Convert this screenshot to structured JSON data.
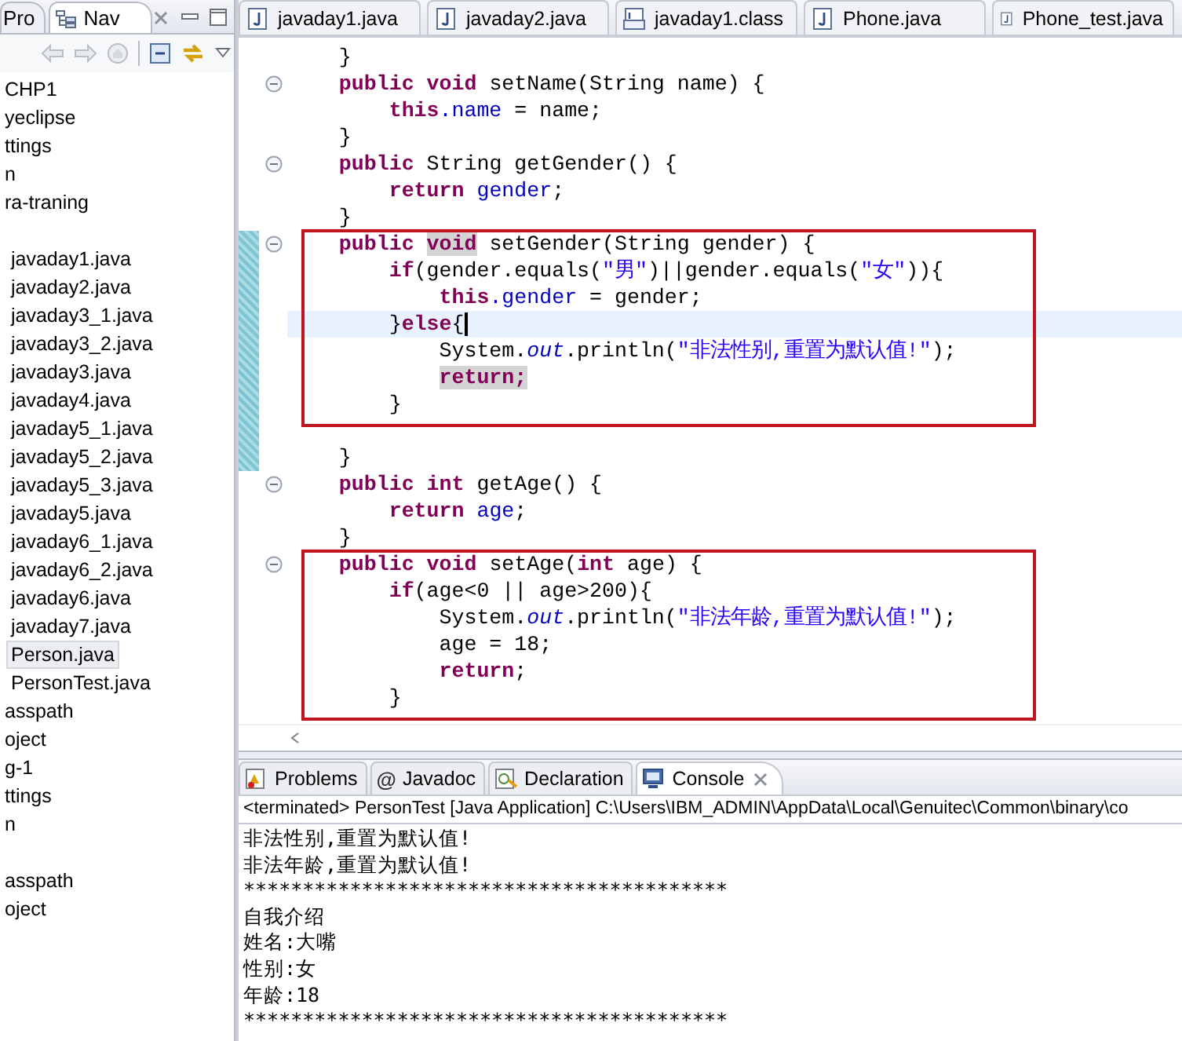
{
  "navigator": {
    "tabs": [
      {
        "label": "Pro",
        "selected": false
      },
      {
        "label": "Nav",
        "selected": true
      }
    ],
    "tree": [
      {
        "kind": "row",
        "label": "CHP1"
      },
      {
        "kind": "row",
        "label": "yeclipse"
      },
      {
        "kind": "row",
        "label": "ttings"
      },
      {
        "kind": "row",
        "label": "n"
      },
      {
        "kind": "row",
        "label": "ra-traning"
      },
      {
        "kind": "blank",
        "children": [
          {
            "label": "javaday1.java",
            "selected": false
          },
          {
            "label": "javaday2.java",
            "selected": false
          },
          {
            "label": "javaday3_1.java",
            "selected": false
          },
          {
            "label": "javaday3_2.java",
            "selected": false
          },
          {
            "label": "javaday3.java",
            "selected": false
          },
          {
            "label": "javaday4.java",
            "selected": false
          },
          {
            "label": "javaday5_1.java",
            "selected": false
          },
          {
            "label": "javaday5_2.java",
            "selected": false
          },
          {
            "label": "javaday5_3.java",
            "selected": false
          },
          {
            "label": "javaday5.java",
            "selected": false
          },
          {
            "label": "javaday6_1.java",
            "selected": false
          },
          {
            "label": "javaday6_2.java",
            "selected": false
          },
          {
            "label": "javaday6.java",
            "selected": false
          },
          {
            "label": "javaday7.java",
            "selected": false
          },
          {
            "label": "Person.java",
            "selected": true
          },
          {
            "label": "PersonTest.java",
            "selected": false
          }
        ]
      },
      {
        "kind": "row",
        "label": "asspath"
      },
      {
        "kind": "row",
        "label": "oject"
      },
      {
        "kind": "row",
        "label": "g-1"
      },
      {
        "kind": "row",
        "label": "ttings"
      },
      {
        "kind": "row",
        "label": "n"
      },
      {
        "kind": "blank"
      },
      {
        "kind": "row",
        "label": "asspath"
      },
      {
        "kind": "row",
        "label": "oject"
      }
    ]
  },
  "editor": {
    "tabs": [
      {
        "label": "javaday1.java",
        "kind": "java"
      },
      {
        "label": "javaday2.java",
        "kind": "java"
      },
      {
        "label": "javaday1.class",
        "kind": "class"
      },
      {
        "label": "Phone.java",
        "kind": "java"
      },
      {
        "label": "Phone_test.java",
        "kind": "java"
      }
    ],
    "blocks": [
      {
        "boxed": false,
        "lines": [
          {
            "tokens": [
              {
                "kind": "plain",
                "text": "    }"
              }
            ],
            "foldable": false,
            "changed": false,
            "current": false
          },
          {
            "tokens": [
              {
                "kind": "keyword",
                "text": "    public"
              },
              {
                "kind": "keyword",
                "text": " void"
              },
              {
                "kind": "plain",
                "text": " setName(String name) {"
              }
            ],
            "foldable": true,
            "changed": false,
            "current": false
          },
          {
            "tokens": [
              {
                "kind": "keyword",
                "text": "        this"
              },
              {
                "kind": "field",
                "text": ".name"
              },
              {
                "kind": "plain",
                "text": " = name;"
              }
            ],
            "foldable": false,
            "changed": false,
            "current": false
          },
          {
            "tokens": [
              {
                "kind": "plain",
                "text": "    }"
              }
            ],
            "foldable": false,
            "changed": false,
            "current": false
          },
          {
            "tokens": [
              {
                "kind": "keyword",
                "text": "    public"
              },
              {
                "kind": "plain",
                "text": " String getGender() {"
              }
            ],
            "foldable": true,
            "changed": false,
            "current": false
          },
          {
            "tokens": [
              {
                "kind": "keyword",
                "text": "        return"
              },
              {
                "kind": "field",
                "text": " gender"
              },
              {
                "kind": "plain",
                "text": ";"
              }
            ],
            "foldable": false,
            "changed": false,
            "current": false
          },
          {
            "tokens": [
              {
                "kind": "plain",
                "text": "    }"
              }
            ],
            "foldable": false,
            "changed": false,
            "current": false
          }
        ]
      },
      {
        "boxed": true,
        "lines": [
          {
            "tokens": [
              {
                "kind": "keyword",
                "text": "    public"
              },
              {
                "kind": "keyword-marked",
                "text": " void"
              },
              {
                "kind": "plain",
                "text": " setGender(String gender) {"
              }
            ],
            "foldable": true,
            "changed": true,
            "current": false
          },
          {
            "tokens": [
              {
                "kind": "keyword",
                "text": "        if"
              },
              {
                "kind": "plain",
                "text": "(gender.equals("
              },
              {
                "kind": "string",
                "text": "\"男\""
              },
              {
                "kind": "plain",
                "text": ")||gender.equals("
              },
              {
                "kind": "string",
                "text": "\"女\""
              },
              {
                "kind": "plain",
                "text": ")){"
              }
            ],
            "foldable": false,
            "changed": true,
            "current": false
          },
          {
            "tokens": [
              {
                "kind": "keyword",
                "text": "            this"
              },
              {
                "kind": "field",
                "text": ".gender"
              },
              {
                "kind": "plain",
                "text": " = gender;"
              }
            ],
            "foldable": false,
            "changed": true,
            "current": false
          },
          {
            "tokens": [
              {
                "kind": "plain",
                "text": "        }"
              },
              {
                "kind": "keyword",
                "text": "else"
              },
              {
                "kind": "plain",
                "text": "{"
              }
            ],
            "foldable": false,
            "changed": true,
            "current": true
          },
          {
            "tokens": [
              {
                "kind": "plain",
                "text": "            System."
              },
              {
                "kind": "static",
                "text": "out"
              },
              {
                "kind": "plain",
                "text": ".println("
              },
              {
                "kind": "string",
                "text": "\"非法性别,重置为默认值!\""
              },
              {
                "kind": "plain",
                "text": ");"
              }
            ],
            "foldable": false,
            "changed": true,
            "current": false
          },
          {
            "tokens": [
              {
                "kind": "keyword-marked",
                "text": "            return;"
              }
            ],
            "foldable": false,
            "changed": true,
            "current": false
          },
          {
            "tokens": [
              {
                "kind": "plain",
                "text": "        }"
              }
            ],
            "foldable": false,
            "changed": true,
            "current": false
          }
        ]
      },
      {
        "boxed": false,
        "lines": [
          {
            "foldable": false,
            "changed": true,
            "current": false
          },
          {
            "tokens": [
              {
                "kind": "plain",
                "text": "    }"
              }
            ],
            "foldable": false,
            "changed": true,
            "current": false
          },
          {
            "tokens": [
              {
                "kind": "keyword",
                "text": "    public"
              },
              {
                "kind": "keyword",
                "text": " int"
              },
              {
                "kind": "plain",
                "text": " getAge() {"
              }
            ],
            "foldable": true,
            "changed": false,
            "current": false
          },
          {
            "tokens": [
              {
                "kind": "keyword",
                "text": "        return"
              },
              {
                "kind": "field",
                "text": " age"
              },
              {
                "kind": "plain",
                "text": ";"
              }
            ],
            "foldable": false,
            "changed": false,
            "current": false
          },
          {
            "tokens": [
              {
                "kind": "plain",
                "text": "    }"
              }
            ],
            "foldable": false,
            "changed": false,
            "current": false
          }
        ]
      },
      {
        "boxed": true,
        "lines": [
          {
            "tokens": [
              {
                "kind": "keyword",
                "text": "    public"
              },
              {
                "kind": "keyword",
                "text": " void"
              },
              {
                "kind": "plain",
                "text": " setAge("
              },
              {
                "kind": "keyword",
                "text": "int"
              },
              {
                "kind": "plain",
                "text": " age) {"
              }
            ],
            "foldable": true,
            "changed": false,
            "current": false
          },
          {
            "tokens": [
              {
                "kind": "keyword",
                "text": "        if"
              },
              {
                "kind": "plain",
                "text": "(age<0 || age>200){"
              }
            ],
            "foldable": false,
            "changed": false,
            "current": false
          },
          {
            "tokens": [
              {
                "kind": "plain",
                "text": "            System."
              },
              {
                "kind": "static",
                "text": "out"
              },
              {
                "kind": "plain",
                "text": ".println("
              },
              {
                "kind": "string",
                "text": "\"非法年龄,重置为默认值!\""
              },
              {
                "kind": "plain",
                "text": ");"
              }
            ],
            "foldable": false,
            "changed": false,
            "current": false
          },
          {
            "tokens": [
              {
                "kind": "plain",
                "text": "            age = 18;"
              }
            ],
            "foldable": false,
            "changed": false,
            "current": false
          },
          {
            "tokens": [
              {
                "kind": "keyword",
                "text": "            return"
              },
              {
                "kind": "plain",
                "text": ";"
              }
            ],
            "foldable": false,
            "changed": false,
            "current": false
          },
          {
            "tokens": [
              {
                "kind": "plain",
                "text": "        }"
              }
            ],
            "foldable": false,
            "changed": false,
            "current": false
          }
        ]
      }
    ]
  },
  "bottom_panel": {
    "tabs": [
      {
        "label": "Problems",
        "kind": "problems",
        "selected": false
      },
      {
        "label": "Javadoc",
        "kind": "javadoc",
        "icon_text": "@",
        "selected": false
      },
      {
        "label": "Declaration",
        "kind": "declaration",
        "selected": false
      },
      {
        "label": "Console",
        "kind": "console",
        "selected": true
      }
    ],
    "console_header": "<terminated> PersonTest [Java Application] C:\\Users\\IBM_ADMIN\\AppData\\Local\\Genuitec\\Common\\binary\\co",
    "output": [
      "非法性别,重置为默认值!",
      "非法年龄,重置为默认值!",
      "*****************************************",
      "自我介绍",
      "姓名:大嘴",
      "性别:女",
      "年龄:18",
      "*****************************************"
    ]
  }
}
